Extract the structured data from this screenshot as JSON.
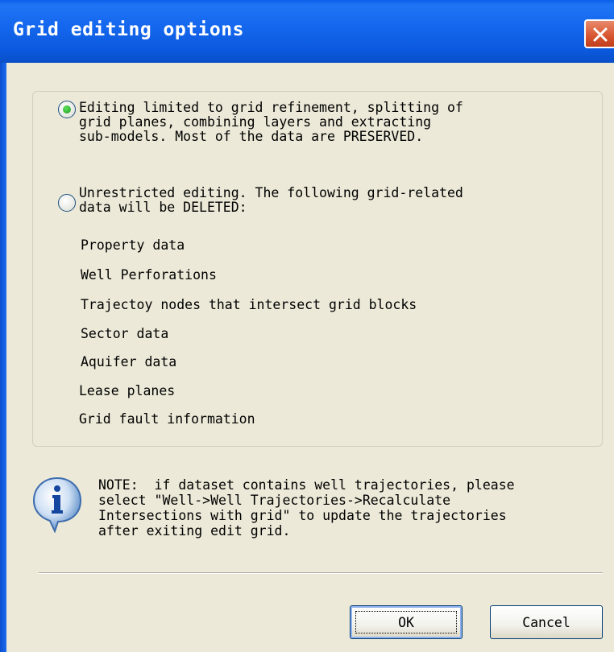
{
  "window": {
    "title": "Grid editing options"
  },
  "options": [
    {
      "label": "Editing limited to grid refinement, splitting of\ngrid planes, combining layers and extracting\nsub-models. Most of the data are PRESERVED.",
      "selected": true
    },
    {
      "label": "Unrestricted editing. The following grid-related\ndata will be DELETED:",
      "selected": false
    }
  ],
  "deleted_items": [
    "Property data",
    "Well Perforations",
    "Trajectoy nodes that intersect grid blocks",
    "Sector data",
    "Aquifer data",
    "Lease planes",
    "Grid fault information"
  ],
  "note": {
    "icon": "info-icon",
    "text": "NOTE:  if dataset contains well trajectories, please\nselect \"Well->Well Trajectories->Recalculate\nIntersections with grid\" to update the trajectories\nafter exiting edit grid."
  },
  "buttons": {
    "ok": "OK",
    "cancel": "Cancel"
  },
  "colors": {
    "titlebar": "#0A5FE8",
    "dialog_bg": "#ECE9D8",
    "close_button": "#D7542F",
    "radio_selected": "#1F9A1F"
  }
}
